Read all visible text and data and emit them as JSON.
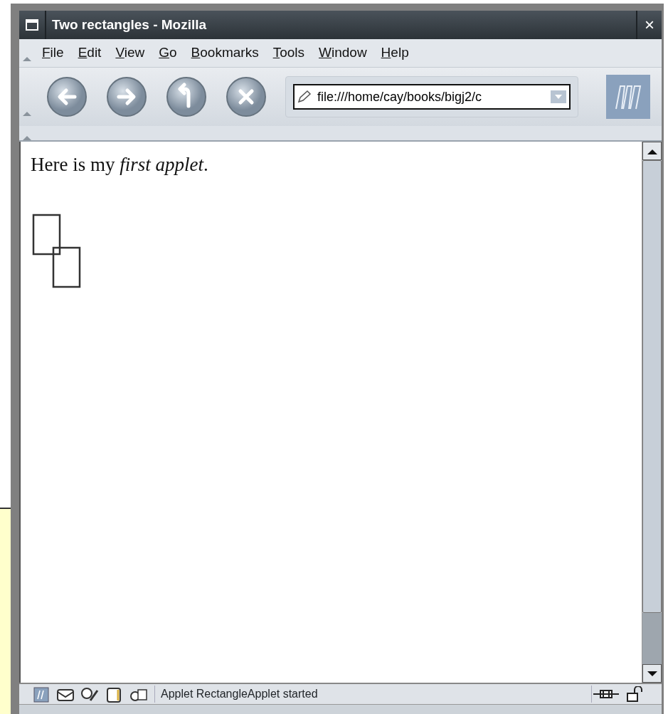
{
  "window": {
    "title": "Two rectangles - Mozilla",
    "close": "×"
  },
  "menu": [
    {
      "label": "File"
    },
    {
      "label": "Edit"
    },
    {
      "label": "View"
    },
    {
      "label": "Go"
    },
    {
      "label": "Bookmarks"
    },
    {
      "label": "Tools"
    },
    {
      "label": "Window"
    },
    {
      "label": "Help"
    }
  ],
  "toolbar": {
    "buttons": [
      {
        "kind": "back"
      },
      {
        "kind": "forward"
      },
      {
        "kind": "reload"
      },
      {
        "kind": "stop"
      }
    ],
    "address": {
      "value": "file:///home/cay/books/bigj2/c"
    }
  },
  "page": {
    "heading": "Here is my *first applet*.",
    "applet": {
      "kind": "rectangles"
    }
  },
  "status_bar": {
    "icons": [
      {
        "kind": "navigator"
      },
      {
        "kind": "mail"
      },
      {
        "kind": "composer"
      },
      {
        "kind": "address-book"
      },
      {
        "kind": "chat"
      }
    ],
    "text": "Applet RectangleApplet started"
  }
}
